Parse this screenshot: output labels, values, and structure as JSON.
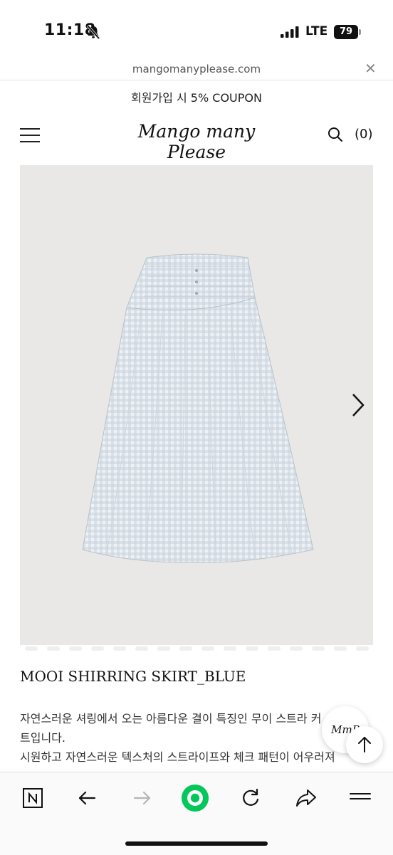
{
  "status_bar": {
    "time": "11:18",
    "network": "LTE",
    "battery": "79"
  },
  "url_bar": {
    "url": "mangomanyplease.com"
  },
  "promo": {
    "text": "회원가입 시 5% COUPON"
  },
  "header": {
    "logo": "Mango many Please",
    "cart_label": "(0)"
  },
  "product": {
    "title": "MOOI SHIRRING SKIRT_BLUE",
    "description": [
      "자연스러운 셔링에서 오는 아름다운 결이 특징인 무이 스트라    커",
      "트입니다.",
      "시원하고 자연스러운 텍스처의 스트라이프와 체크 패턴이 어우러져"
    ]
  },
  "floating": {
    "brand_badge": "MmP"
  },
  "colors": {
    "accent_green": "#03c75a",
    "image_bg": "#e9e8e6"
  }
}
